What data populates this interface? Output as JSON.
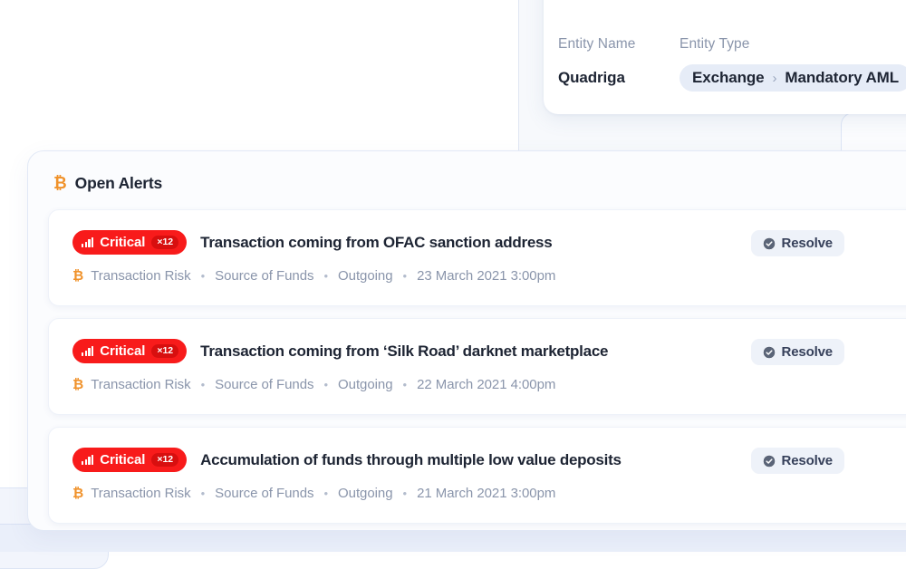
{
  "entity_card": {
    "labels": {
      "entity_name": "Entity Name",
      "entity_type": "Entity Type"
    },
    "values": {
      "entity_name": "Quadriga",
      "entity_type_primary": "Exchange",
      "entity_type_separator": "›",
      "entity_type_secondary": "Mandatory AML"
    }
  },
  "alerts_panel": {
    "icon": "bitcoin-icon",
    "icon_glyph": "₿",
    "title": "Open Alerts",
    "resolve_label": "Resolve",
    "resolve_icon": "check-circle-icon",
    "meta_separator": "•",
    "alerts": [
      {
        "severity": "Critical",
        "severity_icon": "signal-bars-icon",
        "count": "×12",
        "title": "Transaction coming from OFAC sanction address",
        "meta": {
          "icon": "bitcoin-icon",
          "icon_glyph": "₿",
          "category": "Transaction Risk",
          "subcategory": "Source of Funds",
          "direction": "Outgoing",
          "timestamp": "23 March 2021 3:00pm"
        }
      },
      {
        "severity": "Critical",
        "severity_icon": "signal-bars-icon",
        "count": "×12",
        "title": "Transaction coming from ‘Silk Road’ darknet marketplace",
        "meta": {
          "icon": "bitcoin-icon",
          "icon_glyph": "₿",
          "category": "Transaction Risk",
          "subcategory": "Source of Funds",
          "direction": "Outgoing",
          "timestamp": "22 March 2021 4:00pm"
        }
      },
      {
        "severity": "Critical",
        "severity_icon": "signal-bars-icon",
        "count": "×12",
        "title": "Accumulation of funds through multiple low value deposits",
        "meta": {
          "icon": "bitcoin-icon",
          "icon_glyph": "₿",
          "category": "Transaction Risk",
          "subcategory": "Source of Funds",
          "direction": "Outgoing",
          "timestamp": "21 March 2021 3:00pm"
        }
      }
    ]
  },
  "colors": {
    "critical_red": "#f81b1b",
    "critical_count_red": "#d80f0f",
    "bitcoin_orange": "#f0922b",
    "text_primary": "#1d2433",
    "text_muted": "#8a95ab",
    "panel_bg": "#fbfcfe",
    "chip_bg": "#e6ecf7"
  }
}
